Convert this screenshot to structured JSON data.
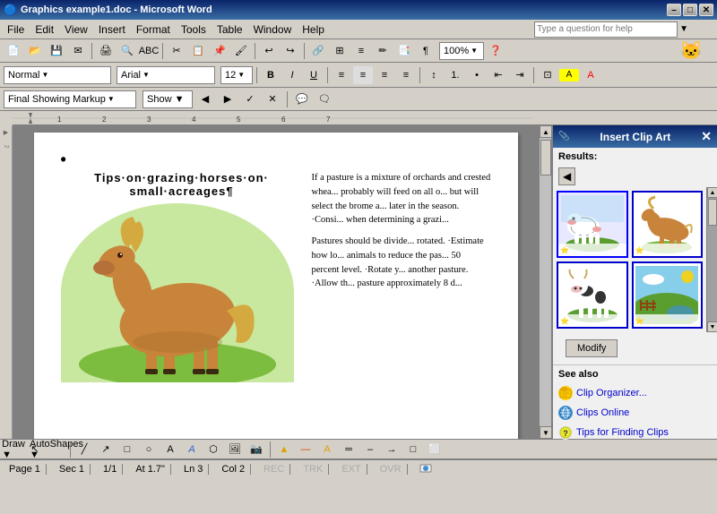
{
  "titlebar": {
    "title": "Graphics example1.doc - Microsoft Word",
    "min": "–",
    "max": "□",
    "close": "✕"
  },
  "menu": {
    "items": [
      "File",
      "Edit",
      "View",
      "Insert",
      "Format",
      "Tools",
      "Table",
      "Window",
      "Help"
    ]
  },
  "toolbar": {
    "question_placeholder": "Type a question for help"
  },
  "formatting": {
    "style": "Normal",
    "font": "Arial",
    "size": "12",
    "bold": "B",
    "italic": "I",
    "underline": "U"
  },
  "tracking": {
    "mode": "Final Showing Markup",
    "show": "Show ▼"
  },
  "document": {
    "title": "Tips on grazing horses on\nsmall acreages¶",
    "body1": "If a pasture is a mixture of orchards and crested whea... probably will feed on all o... but will select the brome a... later in the season. Consi... when determining a grazi...",
    "body2": "Pastures should be divide... rotated. Estimate how lo... animals to reduce the pas... 50 percent level. Rotate y... another pasture. Allow th... pasture approximately 8 d..."
  },
  "clip_art": {
    "title": "Insert Clip Art",
    "results_label": "Results:",
    "modify_label": "Modify",
    "see_also_label": "See also",
    "clip_organizer": "Clip Organizer...",
    "clips_online": "Clips Online",
    "tips_label": "Tips for Finding Clips"
  },
  "statusbar": {
    "page": "Page 1",
    "sec": "Sec 1",
    "position": "1/1",
    "at": "At 1.7\"",
    "ln": "Ln 3",
    "col": "Col 2",
    "rec": "REC",
    "trk": "TRK",
    "ext": "EXT",
    "ovr": "OVR"
  },
  "drawing": {
    "draw": "Draw ▼",
    "autoshapes": "AutoShapes ▼"
  }
}
